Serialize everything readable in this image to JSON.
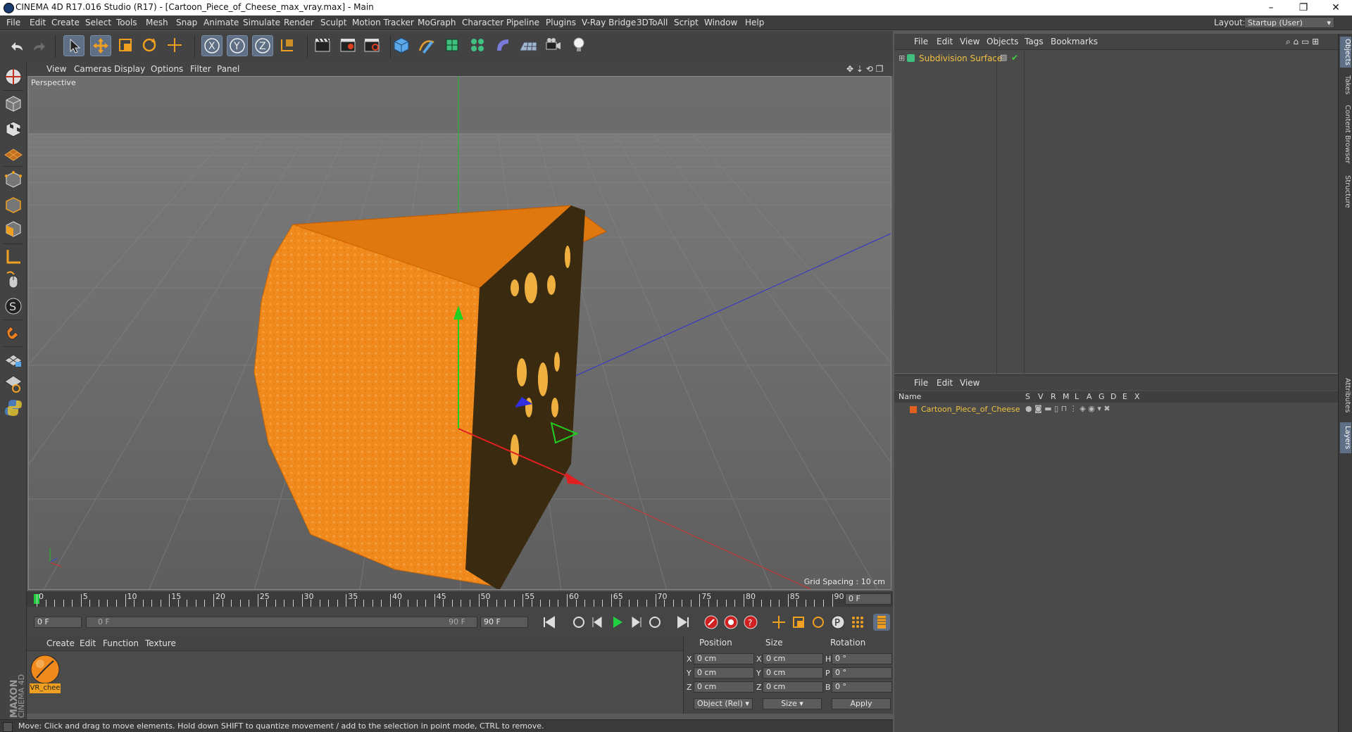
{
  "window": {
    "title": "CINEMA 4D R17.016 Studio (R17) - [Cartoon_Piece_of_Cheese_max_vray.max] - Main",
    "minimize": "–",
    "restore": "❐",
    "close": "✕"
  },
  "menubar": {
    "items": [
      "File",
      "Edit",
      "Create",
      "Select",
      "Tools",
      "Mesh",
      "Snap",
      "Animate",
      "Simulate",
      "Render",
      "Sculpt",
      "Motion Tracker",
      "MoGraph",
      "Character",
      "Pipeline",
      "Plugins",
      "V-Ray Bridge",
      "3DToAll",
      "Script",
      "Window",
      "Help"
    ],
    "layout_label": "Layout:",
    "layout_value": "Startup (User)"
  },
  "viewport": {
    "menu": [
      "View",
      "Cameras",
      "Display",
      "Options",
      "Filter",
      "Panel"
    ],
    "label": "Perspective",
    "grid_spacing": "Grid Spacing : 10 cm"
  },
  "timeline": {
    "ticks": [
      "0",
      "5",
      "10",
      "15",
      "20",
      "25",
      "30",
      "35",
      "40",
      "45",
      "50",
      "55",
      "60",
      "65",
      "70",
      "75",
      "80",
      "85",
      "90"
    ],
    "current_frame": "0 F",
    "start_field": "0 F",
    "range_start": "0 F",
    "range_end": "90 F",
    "end_field": "90 F"
  },
  "material_panel": {
    "menu": [
      "Create",
      "Edit",
      "Function",
      "Texture"
    ],
    "material_name": "VR_chee"
  },
  "coordinates": {
    "headers": [
      "Position",
      "Size",
      "Rotation"
    ],
    "rows": [
      {
        "axis": "X",
        "pos": "0 cm",
        "size_axis": "X",
        "size": "0 cm",
        "rot_axis": "H",
        "rot": "0 °"
      },
      {
        "axis": "Y",
        "pos": "0 cm",
        "size_axis": "Y",
        "size": "0 cm",
        "rot_axis": "P",
        "rot": "0 °"
      },
      {
        "axis": "Z",
        "pos": "0 cm",
        "size_axis": "Z",
        "size": "0 cm",
        "rot_axis": "B",
        "rot": "0 °"
      }
    ],
    "mode_select": "Object (Rel)",
    "size_select": "Size",
    "apply": "Apply"
  },
  "status": "Move: Click and drag to move elements. Hold down SHIFT to quantize movement / add to the selection in point mode, CTRL to remove.",
  "objects_panel": {
    "menu": [
      "File",
      "Edit",
      "View",
      "Objects",
      "Tags",
      "Bookmarks"
    ],
    "items": [
      {
        "name": "Subdivision Surface"
      }
    ]
  },
  "layers_panel": {
    "menu": [
      "File",
      "Edit",
      "View"
    ],
    "columns": [
      "Name",
      "S",
      "V",
      "R",
      "M",
      "L",
      "A",
      "G",
      "D",
      "E",
      "X"
    ],
    "items": [
      {
        "name": "Cartoon_Piece_of_Cheese"
      }
    ]
  },
  "side_tabs": [
    "Objects",
    "Takes",
    "Content Browser",
    "Structure",
    "Attributes",
    "Layers"
  ],
  "brand": "MAXON CINEMA 4D",
  "colors": {
    "accent": "#5f6f86",
    "cheese": "#f08a1c",
    "highlight_text": "#f0c040"
  }
}
